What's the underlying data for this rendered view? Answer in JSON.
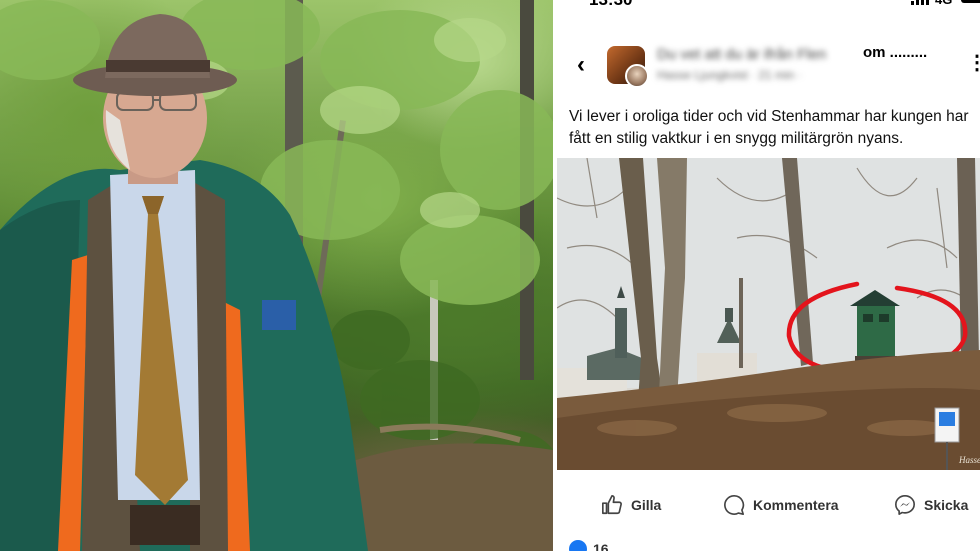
{
  "status_bar": {
    "time": "13:30",
    "network": "4G"
  },
  "post": {
    "page_name": "Du vet att du är ifrån Flen",
    "title_suffix": "om .........",
    "author_meta": "Hasse Ljungkvist · 21 min · ",
    "text": "Vi lever i oroliga tider och vid Stenhammar har kungen har fått en stilig vaktkur i en snygg militärgrön nyans.",
    "image_watermark": "Hasse"
  },
  "actions": {
    "like": "Gilla",
    "comment": "Kommentera",
    "share": "Skicka"
  },
  "reactions": {
    "count": "16"
  },
  "colors": {
    "highlight_circle": "#e3141c",
    "like_blue": "#1877f2",
    "sign_blue": "#2a7de1"
  },
  "icons": [
    "chevron-left-icon",
    "more-icon",
    "thumbs-up-icon",
    "comment-icon",
    "messenger-icon",
    "signal-icon",
    "battery-icon"
  ]
}
